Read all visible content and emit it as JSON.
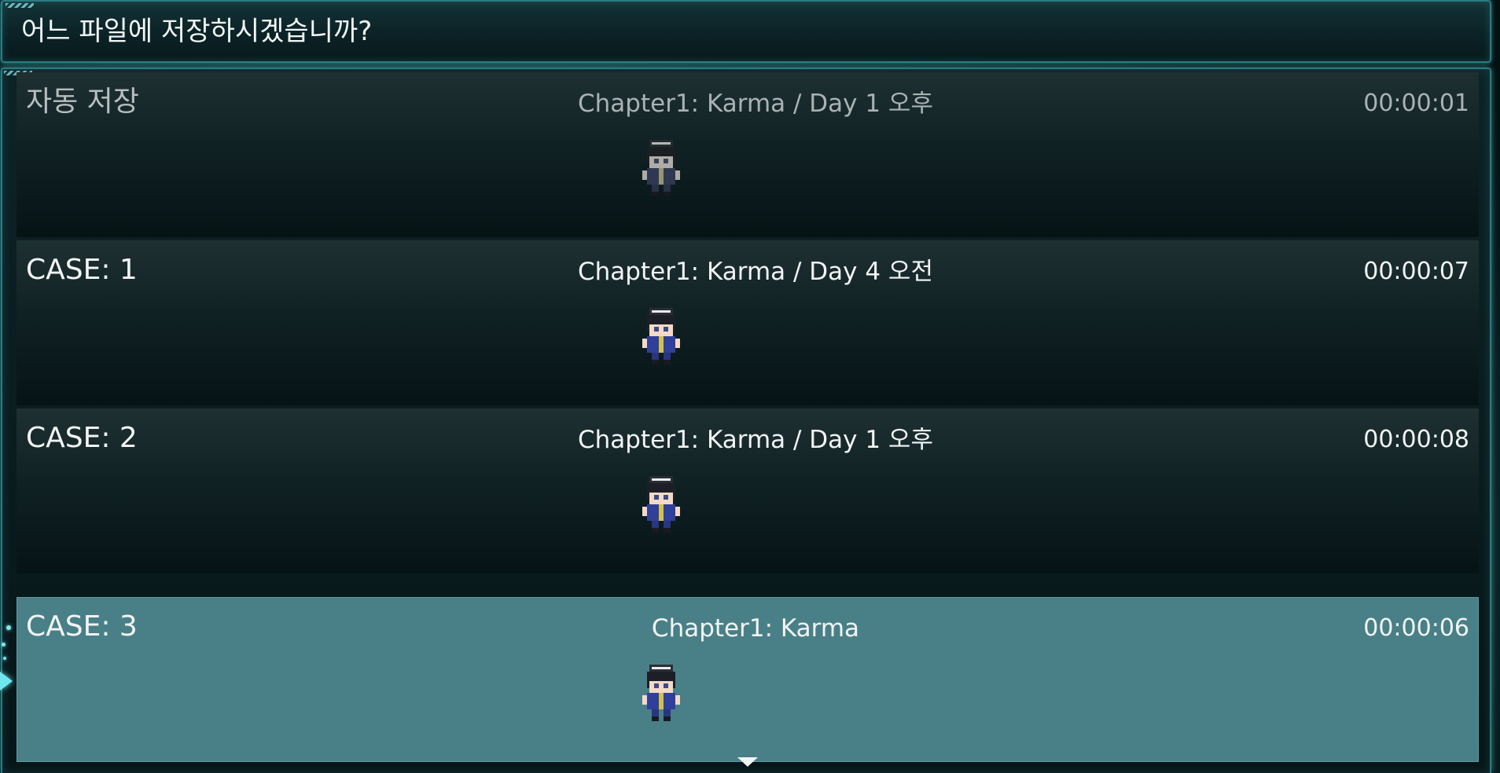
{
  "prompt": {
    "text": "어느 파일에 저장하시겠습니까?"
  },
  "slots": [
    {
      "title": "자동 저장",
      "chapter": "Chapter1: Karma / Day 1 오후",
      "playtime": "00:00:01",
      "sprite_icon": "character-sprite-icon",
      "dimmed": true,
      "selected": false
    },
    {
      "title": "CASE:  1",
      "chapter": "Chapter1: Karma / Day 4 오전",
      "playtime": "00:00:07",
      "sprite_icon": "character-sprite-icon",
      "dimmed": false,
      "selected": false
    },
    {
      "title": "CASE:  2",
      "chapter": "Chapter1: Karma / Day 1 오후",
      "playtime": "00:00:08",
      "sprite_icon": "character-sprite-icon",
      "dimmed": false,
      "selected": false
    },
    {
      "title": "CASE:  3",
      "chapter": "Chapter1: Karma",
      "playtime": "00:00:06",
      "sprite_icon": "character-sprite-icon",
      "dimmed": false,
      "selected": true
    }
  ],
  "icons": {
    "scroll_down": "chevron-down-icon",
    "cursor": "cursor-arrow-icon"
  },
  "colors": {
    "frame_border": "#2c7a82",
    "frame_glow": "#5adce6",
    "selected_row": "#498087",
    "text": "#f2f4f4"
  }
}
